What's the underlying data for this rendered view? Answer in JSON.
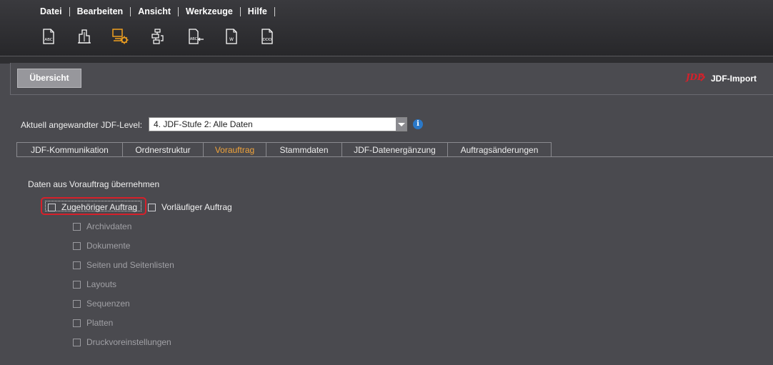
{
  "menu": {
    "items": [
      "Datei",
      "Bearbeiten",
      "Ansicht",
      "Werkzeuge",
      "Hilfe"
    ]
  },
  "toolbar": {
    "icons": [
      "abc-document-icon",
      "building-icon",
      "computer-gear-icon",
      "workflow-icon",
      "abc-import-icon",
      "document-check-icon",
      "document-ddd-icon"
    ],
    "accent": "#f0a020"
  },
  "header": {
    "overview_tab": "Übersicht",
    "module_title": "JDF-Import",
    "logo_text": "JDF"
  },
  "level": {
    "label": "Aktuell angewandter JDF-Level:",
    "selected": "4. JDF-Stufe 2: Alle Daten",
    "info_icon": "i"
  },
  "tabs": [
    {
      "label": "JDF-Kommunikation",
      "active": false
    },
    {
      "label": "Ordnerstruktur",
      "active": false
    },
    {
      "label": "Vorauftrag",
      "active": true
    },
    {
      "label": "Stammdaten",
      "active": false
    },
    {
      "label": "JDF-Datenergänzung",
      "active": false
    },
    {
      "label": "Auftragsänderungen",
      "active": false
    }
  ],
  "content": {
    "section_title": "Daten aus Vorauftrag übernehmen",
    "primary_options": [
      {
        "label": "Zugehöriger Auftrag",
        "checked": false
      },
      {
        "label": "Vorläufiger Auftrag",
        "checked": false
      }
    ],
    "sub_options": [
      {
        "label": "Archivdaten",
        "checked": false,
        "enabled": false
      },
      {
        "label": "Dokumente",
        "checked": false,
        "enabled": false
      },
      {
        "label": "Seiten und Seitenlisten",
        "checked": false,
        "enabled": false
      },
      {
        "label": "Layouts",
        "checked": false,
        "enabled": false
      },
      {
        "label": "Sequenzen",
        "checked": false,
        "enabled": false
      },
      {
        "label": "Platten",
        "checked": false,
        "enabled": false
      },
      {
        "label": "Druckvoreinstellungen",
        "checked": false,
        "enabled": false
      }
    ]
  },
  "colors": {
    "active_tab": "#f0a33a",
    "highlight": "#d6202a",
    "info": "#2a78c8"
  }
}
